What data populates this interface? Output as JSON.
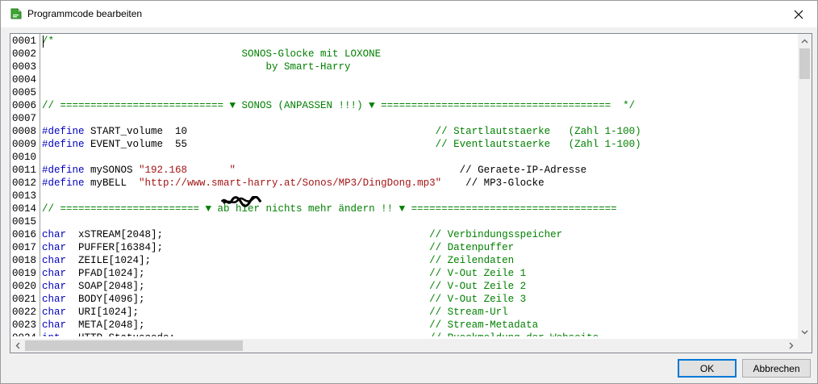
{
  "window": {
    "title": "Programmcode bearbeiten",
    "icon": "green-document-icon",
    "accent_color": "#0078d7"
  },
  "editor": {
    "lines": [
      {
        "num": "0001",
        "parts": [
          [
            "cm",
            "/*"
          ]
        ]
      },
      {
        "num": "0002",
        "parts": [
          [
            "cm",
            "                                 SONOS-Glocke mit LOXONE"
          ]
        ]
      },
      {
        "num": "0003",
        "parts": [
          [
            "cm",
            "                                     by Smart-Harry"
          ]
        ]
      },
      {
        "num": "0004",
        "parts": []
      },
      {
        "num": "0005",
        "parts": []
      },
      {
        "num": "0006",
        "parts": [
          [
            "cm",
            "// =========================== ▼ SONOS (ANPASSEN !!!) ▼ ======================================  */"
          ]
        ]
      },
      {
        "num": "0007",
        "parts": []
      },
      {
        "num": "0008",
        "parts": [
          [
            "kw",
            "#define"
          ],
          [
            "txt",
            " START_volume  10                                         "
          ],
          [
            "cm",
            "// Startlautstaerke   (Zahl 1-100)"
          ]
        ]
      },
      {
        "num": "0009",
        "parts": [
          [
            "kw",
            "#define"
          ],
          [
            "txt",
            " EVENT_volume  55                                         "
          ],
          [
            "cm",
            "// Eventlautstaerke   (Zahl 1-100)"
          ]
        ]
      },
      {
        "num": "0010",
        "parts": []
      },
      {
        "num": "0011",
        "parts": [
          [
            "kw",
            "#define"
          ],
          [
            "txt",
            " mySONOS "
          ],
          [
            "str",
            "\"192.168       \""
          ],
          [
            "txt",
            "                                     "
          ],
          [
            "txt",
            "// Geraete-IP-Adresse"
          ]
        ]
      },
      {
        "num": "0012",
        "parts": [
          [
            "kw",
            "#define"
          ],
          [
            "txt",
            " myBELL  "
          ],
          [
            "str",
            "\"http://www.smart-harry.at/Sonos/MP3/DingDong.mp3\""
          ],
          [
            "txt",
            "    // MP3-Glocke"
          ]
        ]
      },
      {
        "num": "0013",
        "parts": []
      },
      {
        "num": "0014",
        "parts": [
          [
            "cm",
            "// ======================= ▼ ab hier nichts mehr ändern !! ▼ =================================="
          ]
        ]
      },
      {
        "num": "0015",
        "parts": []
      },
      {
        "num": "0016",
        "parts": [
          [
            "kw",
            "char"
          ],
          [
            "txt",
            "  xSTREAM[2048];                                            "
          ],
          [
            "cm",
            "// Verbindungsspeicher"
          ]
        ]
      },
      {
        "num": "0017",
        "parts": [
          [
            "kw",
            "char"
          ],
          [
            "txt",
            "  PUFFER[16384];                                            "
          ],
          [
            "cm",
            "// Datenpuffer"
          ]
        ]
      },
      {
        "num": "0018",
        "parts": [
          [
            "kw",
            "char"
          ],
          [
            "txt",
            "  ZEILE[1024];                                              "
          ],
          [
            "cm",
            "// Zeilendaten"
          ]
        ]
      },
      {
        "num": "0019",
        "parts": [
          [
            "kw",
            "char"
          ],
          [
            "txt",
            "  PFAD[1024];                                               "
          ],
          [
            "cm",
            "// V-Out Zeile 1"
          ]
        ]
      },
      {
        "num": "0020",
        "parts": [
          [
            "kw",
            "char"
          ],
          [
            "txt",
            "  SOAP[2048];                                               "
          ],
          [
            "cm",
            "// V-Out Zeile 2"
          ]
        ]
      },
      {
        "num": "0021",
        "parts": [
          [
            "kw",
            "char"
          ],
          [
            "txt",
            "  BODY[4096];                                               "
          ],
          [
            "cm",
            "// V-Out Zeile 3"
          ]
        ]
      },
      {
        "num": "0022",
        "parts": [
          [
            "kw",
            "char"
          ],
          [
            "txt",
            "  URI[1024];                                                "
          ],
          [
            "cm",
            "// Stream-Url"
          ]
        ]
      },
      {
        "num": "0023",
        "parts": [
          [
            "kw",
            "char"
          ],
          [
            "txt",
            "  META[2048];                                               "
          ],
          [
            "cm",
            "// Stream-Metadata"
          ]
        ]
      },
      {
        "num": "0024",
        "parts": [
          [
            "kw",
            "int"
          ],
          [
            "txt",
            "   HTTP_Statuscode;                                          "
          ],
          [
            "cm",
            "// Rueckmeldung der Webseite"
          ]
        ]
      }
    ]
  },
  "buttons": {
    "ok_label": "OK",
    "cancel_label": "Abbrechen"
  }
}
